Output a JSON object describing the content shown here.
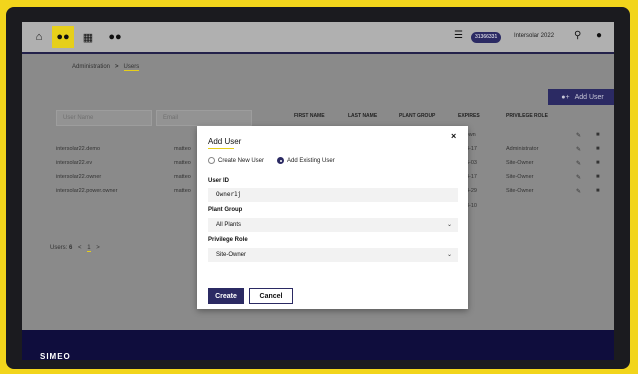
{
  "topnav": {
    "site_badge": "31366331",
    "site_name": "Intersolar 2022"
  },
  "breadcrumb": {
    "root": "Administration",
    "separator": ">",
    "current": "Users"
  },
  "toolbar": {
    "add_user_label": "Add User"
  },
  "table": {
    "filters": [
      "User Name",
      "Email"
    ],
    "headers": [
      "FIRST NAME",
      "LAST NAME",
      "PLANT GROUP",
      "EXPIRES",
      "PRIVILEGE ROLE"
    ],
    "rows": [
      {
        "user": "",
        "email": "",
        "expires": "...nown",
        "role": ""
      },
      {
        "user": "intersolar22.demo",
        "email": "matteo",
        "expires": "2-04-17",
        "role": "Administrator"
      },
      {
        "user": "intersolar22.ev",
        "email": "matteo",
        "expires": "2-05-03",
        "role": "Site-Owner"
      },
      {
        "user": "intersolar22.owner",
        "email": "matteo",
        "expires": "2-04-17",
        "role": "Site-Owner"
      },
      {
        "user": "intersolar22.power.owner",
        "email": "matteo",
        "expires": "2-04-29",
        "role": "Site-Owner"
      },
      {
        "user": "",
        "email": "",
        "expires": "2-03-10",
        "role": ""
      }
    ]
  },
  "pager": {
    "label": "Users:",
    "count": "6",
    "prev": "<",
    "page": "1",
    "next": ">"
  },
  "footer": {
    "logo": "SIMEO"
  },
  "modal": {
    "title": "Add User",
    "close": "×",
    "radio_new": "Create New User",
    "radio_existing": "Add Existing User",
    "user_id_label": "User ID",
    "user_id_value": "Owner1j",
    "plant_group_label": "Plant Group",
    "plant_group_value": "All Plants",
    "privilege_role_label": "Privilege Role",
    "privilege_role_value": "Site-Owner",
    "create_label": "Create",
    "cancel_label": "Cancel"
  },
  "colors": {
    "accent": "#e6cf1a",
    "brand": "#2b2a63",
    "footer": "#0f0d3d"
  }
}
